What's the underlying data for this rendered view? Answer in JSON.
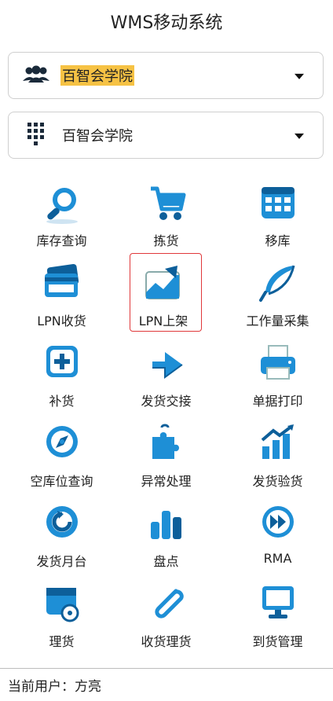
{
  "app": {
    "title": "WMS移动系统"
  },
  "org_select": {
    "value": "百智会学院",
    "icon": "users-icon"
  },
  "warehouse_select": {
    "value": "百智会学院",
    "icon": "grid-icon"
  },
  "menu": [
    {
      "label": "库存查询",
      "icon": "magnifier-icon"
    },
    {
      "label": "拣货",
      "icon": "cart-icon"
    },
    {
      "label": "移库",
      "icon": "calendar-grid-icon"
    },
    {
      "label": "LPN收货",
      "icon": "card-icon"
    },
    {
      "label": "LPN上架",
      "icon": "chart-up-icon"
    },
    {
      "label": "工作量采集",
      "icon": "feather-icon"
    },
    {
      "label": "补货",
      "icon": "plus-box-icon"
    },
    {
      "label": "发货交接",
      "icon": "arrow-right-icon"
    },
    {
      "label": "单据打印",
      "icon": "printer-icon"
    },
    {
      "label": "空库位查询",
      "icon": "compass-icon"
    },
    {
      "label": "异常处理",
      "icon": "puzzle-icon"
    },
    {
      "label": "发货验货",
      "icon": "bar-chart-up-icon"
    },
    {
      "label": "发货月台",
      "icon": "refresh-icon"
    },
    {
      "label": "盘点",
      "icon": "bar-chart-icon"
    },
    {
      "label": "RMA",
      "icon": "fast-forward-icon"
    },
    {
      "label": "理货",
      "icon": "disk-box-icon"
    },
    {
      "label": "收货理货",
      "icon": "paperclip-icon"
    },
    {
      "label": "到货管理",
      "icon": "monitor-icon"
    }
  ],
  "selected_item": "LPN上架",
  "footer": {
    "label": "当前用户：",
    "value": "方亮"
  },
  "colors": {
    "icon_blue": "#1e8fd6",
    "icon_dark": "#0d5f9a",
    "highlight": "#f6c244",
    "selected_border": "#e0383a"
  }
}
